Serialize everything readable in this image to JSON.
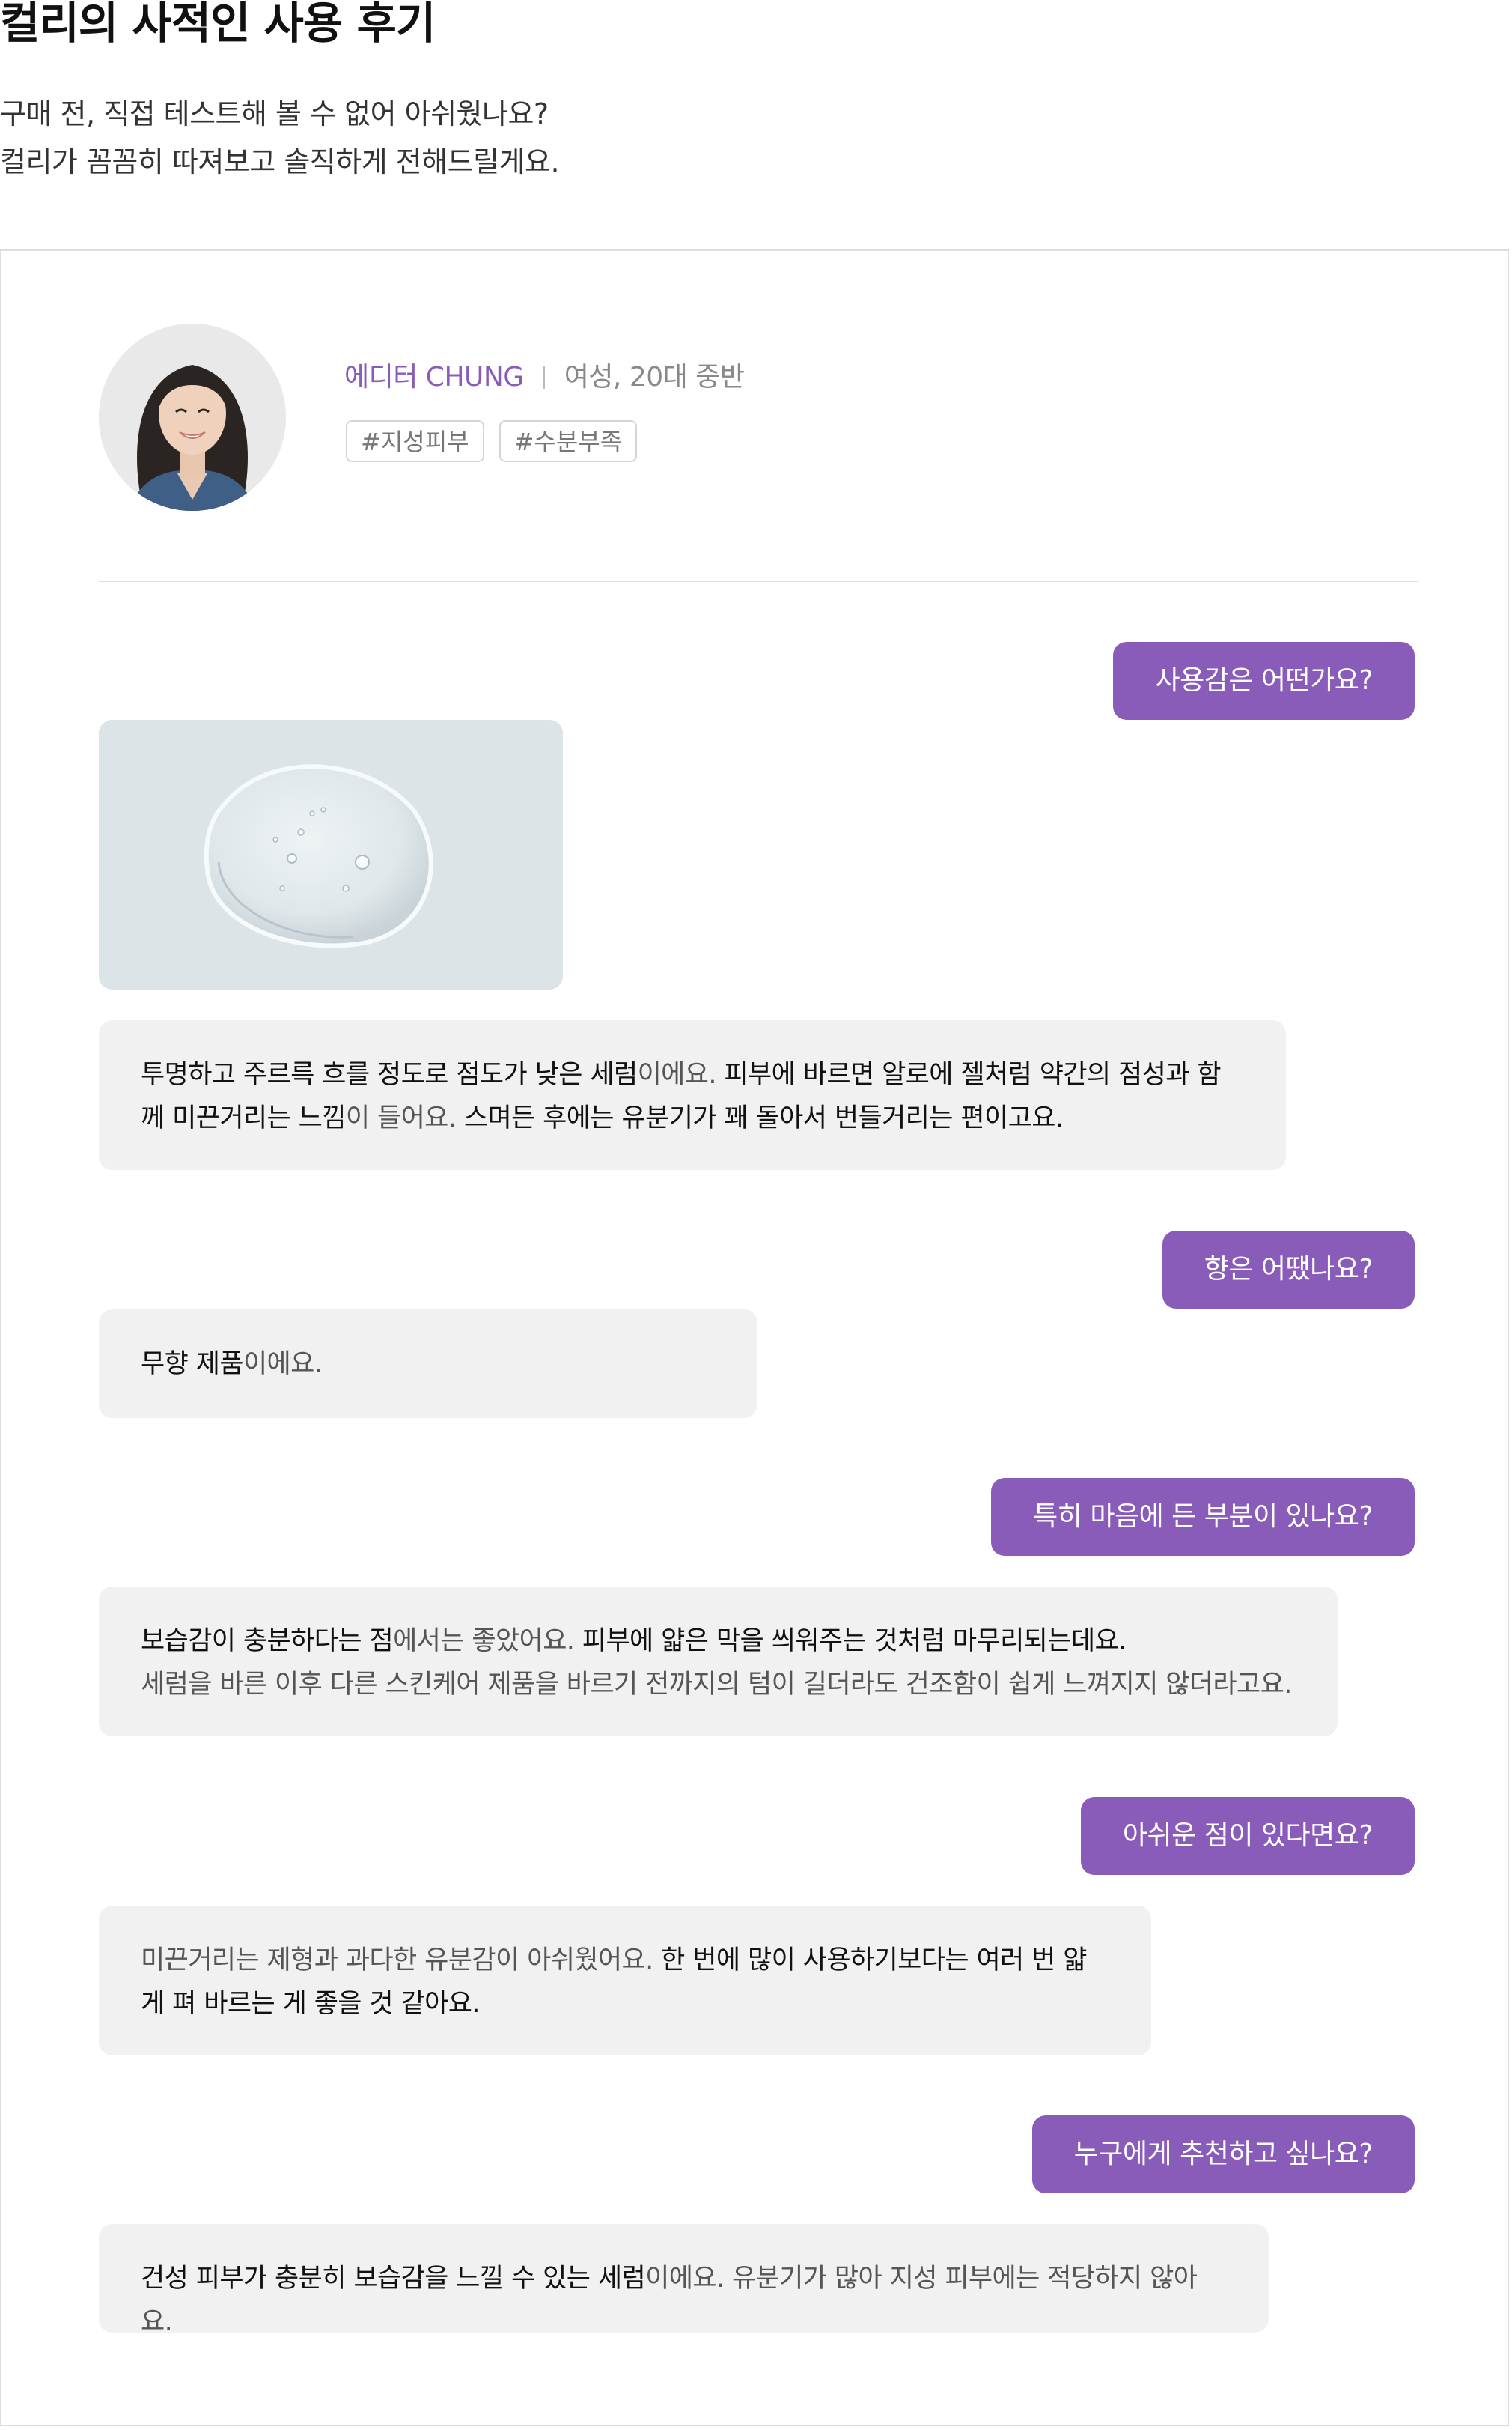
{
  "header": {
    "title": "컬리의 사적인 사용 후기",
    "intro_line1": "구매 전, 직접 테스트해 볼 수 없어 아쉬웠나요?",
    "intro_line2": "컬리가 꼼꼼히 따져보고 솔직하게 전해드릴게요."
  },
  "profile": {
    "editor": "에디터 CHUNG",
    "description": "여성, 20대 중반",
    "tags": [
      "#지성피부",
      "#수분부족"
    ]
  },
  "qa": [
    {
      "question": "사용감은 어떤가요?",
      "answer": [
        {
          "text": "투명하고 주르륵 흐를 정도로 점도가 낮은 세럼",
          "bold": true
        },
        {
          "text": "이에요. ",
          "bold": false
        },
        {
          "text": "피부에 바르면 알로에 젤처럼 약간의 점성과 함께 미끈거리는 느낌",
          "bold": true
        },
        {
          "text": "이 들어요. ",
          "bold": false
        },
        {
          "text": "스며든 후에는 유분기가 꽤 돌아서 번들거리는 편이고요.",
          "bold": true
        }
      ]
    },
    {
      "question": "향은 어땠나요?",
      "answer": [
        {
          "text": "무향 제품",
          "bold": true
        },
        {
          "text": "이에요.",
          "bold": false
        }
      ]
    },
    {
      "question": "특히 마음에 든 부분이 있나요?",
      "answer": [
        {
          "text": "보습감이 충분하다는 점",
          "bold": true
        },
        {
          "text": "에서는 좋았어요. ",
          "bold": false
        },
        {
          "text": "피부에 얇은 막을 씌워주는 것처럼 마무리되는데요.",
          "bold": true
        },
        {
          "text": "세럼을 바른 이후 다른 스킨케어 제품을 바르기 전까지의 텀이 길더라도 건조함이 쉽게 느껴지지 않더라고요.",
          "bold": false
        }
      ]
    },
    {
      "question": "아쉬운 점이 있다면요?",
      "answer": [
        {
          "text": "미끈거리는 제형과 과다한 유분감이 아쉬웠어요. ",
          "bold": false
        },
        {
          "text": "한 번에 많이 사용하기보다는 여러 번 얇게 펴 바르는 게 좋을 것 같아요.",
          "bold": true
        }
      ]
    },
    {
      "question": "누구에게 추천하고 싶나요?",
      "answer": [
        {
          "text": "건성 피부가 충분히 보습감을 느낄 수 있는 세럼",
          "bold": true
        },
        {
          "text": "이에요. 유분기가 많아 지성 피부에는 적당하지 않아요.",
          "bold": false
        }
      ]
    }
  ],
  "colors": {
    "accent": "#8a5cba",
    "answer_bg": "#f1f1f1",
    "border": "#dcdcdc"
  }
}
